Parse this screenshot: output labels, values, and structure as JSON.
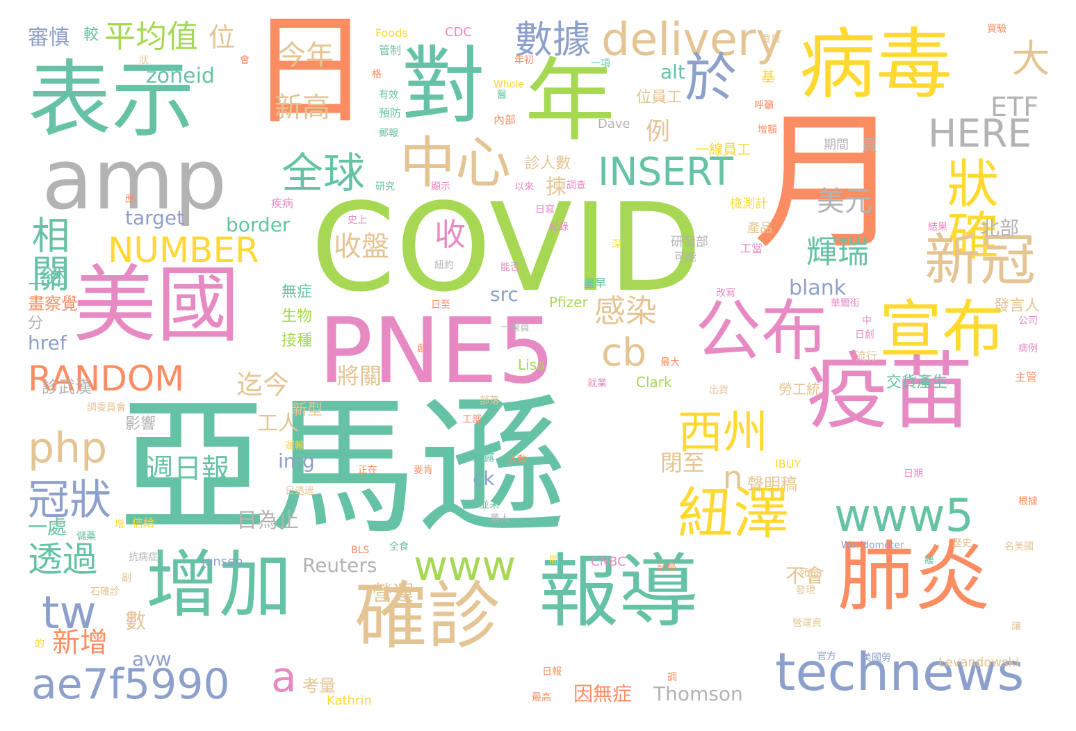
{
  "palette": {
    "teal": "#66c2a5",
    "coral": "#fc8d62",
    "blue": "#8da0cb",
    "pink": "#e78ac3",
    "green": "#a6d854",
    "yellow": "#ffd92f",
    "tan": "#e5c494",
    "gray": "#b3b3b3"
  },
  "words": [
    {
      "text": "亞馬遜",
      "color": "teal"
    },
    {
      "text": "COVID",
      "color": "green"
    },
    {
      "text": "月",
      "color": "coral"
    },
    {
      "text": "PNE5",
      "color": "pink"
    },
    {
      "text": "表示",
      "color": "teal"
    },
    {
      "text": "日",
      "color": "coral"
    },
    {
      "text": "對",
      "color": "teal"
    },
    {
      "text": "年",
      "color": "green"
    },
    {
      "text": "病毒",
      "color": "yellow"
    },
    {
      "text": "amp",
      "color": "gray"
    },
    {
      "text": "美國",
      "color": "pink"
    },
    {
      "text": "疫苗",
      "color": "pink"
    },
    {
      "text": "增加",
      "color": "teal"
    },
    {
      "text": "確診",
      "color": "tan"
    },
    {
      "text": "報導",
      "color": "teal"
    },
    {
      "text": "肺炎",
      "color": "coral"
    },
    {
      "text": "公布",
      "color": "pink"
    },
    {
      "text": "宣布",
      "color": "yellow"
    },
    {
      "text": "delivery",
      "color": "tan"
    },
    {
      "text": "於",
      "color": "blue"
    },
    {
      "text": "中心",
      "color": "tan"
    },
    {
      "text": "狀確",
      "color": "yellow"
    },
    {
      "text": "新冠",
      "color": "tan"
    },
    {
      "text": "technews",
      "color": "blue"
    },
    {
      "text": "ae7f5990",
      "color": "blue"
    },
    {
      "text": "紐澤",
      "color": "yellow"
    },
    {
      "text": "西州",
      "color": "yellow"
    },
    {
      "text": "www5",
      "color": "teal"
    },
    {
      "text": "www",
      "color": "green"
    },
    {
      "text": "RANDOM",
      "color": "coral"
    },
    {
      "text": "NUMBER",
      "color": "yellow"
    },
    {
      "text": "INSERT",
      "color": "teal"
    },
    {
      "text": "HERE",
      "color": "gray"
    },
    {
      "text": "數據",
      "color": "blue"
    },
    {
      "text": "全球",
      "color": "teal"
    },
    {
      "text": "大",
      "color": "tan"
    },
    {
      "text": "相關",
      "color": "teal"
    },
    {
      "text": "平均值",
      "color": "green"
    },
    {
      "text": "位",
      "color": "tan"
    },
    {
      "text": "審慎",
      "color": "blue"
    },
    {
      "text": "較",
      "color": "teal"
    },
    {
      "text": "今年",
      "color": "tan"
    },
    {
      "text": "新高",
      "color": "tan"
    },
    {
      "text": "zoneid",
      "color": "teal"
    },
    {
      "text": "php",
      "color": "tan"
    },
    {
      "text": "冠狀",
      "color": "blue"
    },
    {
      "text": "tw",
      "color": "blue"
    },
    {
      "text": "透過",
      "color": "teal"
    },
    {
      "text": "cb",
      "color": "tan"
    },
    {
      "text": "感染",
      "color": "tan"
    },
    {
      "text": "收盤",
      "color": "tan"
    },
    {
      "text": "收",
      "color": "pink"
    },
    {
      "text": "輝瑞",
      "color": "teal"
    },
    {
      "text": "美元",
      "color": "gray"
    },
    {
      "text": "ETF",
      "color": "gray"
    },
    {
      "text": "alt",
      "color": "teal"
    },
    {
      "text": "例",
      "color": "tan"
    },
    {
      "text": "迄今",
      "color": "tan"
    },
    {
      "text": "週日報",
      "color": "teal"
    },
    {
      "text": "n",
      "color": "tan"
    },
    {
      "text": "a",
      "color": "pink"
    },
    {
      "text": "新增",
      "color": "coral"
    },
    {
      "text": "target",
      "color": "blue"
    },
    {
      "text": "border",
      "color": "teal"
    },
    {
      "text": "上述",
      "color": "teal"
    },
    {
      "text": "src",
      "color": "blue"
    },
    {
      "text": "blank",
      "color": "blue"
    },
    {
      "text": "北部",
      "color": "gray"
    },
    {
      "text": "工人",
      "color": "tan"
    },
    {
      "text": "img",
      "color": "blue"
    },
    {
      "text": "閉至",
      "color": "tan"
    },
    {
      "text": "將關",
      "color": "tan"
    },
    {
      "text": "日為止",
      "color": "gray"
    },
    {
      "text": "Reuters",
      "color": "gray"
    },
    {
      "text": "Thomson",
      "color": "gray"
    },
    {
      "text": "營運",
      "color": "tan"
    },
    {
      "text": "不會",
      "color": "tan"
    },
    {
      "text": "因無症",
      "color": "coral"
    },
    {
      "text": "考量",
      "color": "tan"
    },
    {
      "text": "聲明稿",
      "color": "tan"
    },
    {
      "text": "一處",
      "color": "teal"
    },
    {
      "text": "avw",
      "color": "blue"
    },
    {
      "text": "ck",
      "color": "blue"
    },
    {
      "text": "數",
      "color": "tan"
    },
    {
      "text": "href",
      "color": "blue"
    },
    {
      "text": "分",
      "color": "gray"
    },
    {
      "text": "畫察覺",
      "color": "coral"
    },
    {
      "text": "生物",
      "color": "green"
    },
    {
      "text": "無症",
      "color": "teal"
    },
    {
      "text": "接種",
      "color": "green"
    },
    {
      "text": "新型",
      "color": "tan"
    },
    {
      "text": "影響",
      "color": "gray"
    },
    {
      "text": "診武漢",
      "color": "gray"
    },
    {
      "text": "位員工",
      "color": "tan"
    },
    {
      "text": "一線員工",
      "color": "yellow"
    },
    {
      "text": "員",
      "color": "gray"
    },
    {
      "text": "期間",
      "color": "gray"
    },
    {
      "text": "揀",
      "color": "tan"
    },
    {
      "text": "診人數",
      "color": "tan"
    },
    {
      "text": "檢測計",
      "color": "yellow"
    },
    {
      "text": "產品",
      "color": "tan"
    },
    {
      "text": "研發部",
      "color": "gray"
    },
    {
      "text": "可能",
      "color": "gray"
    },
    {
      "text": "工當",
      "color": "pink"
    },
    {
      "text": "Pfizer",
      "color": "green"
    },
    {
      "text": "發言人",
      "color": "tan"
    },
    {
      "text": "交貨產生",
      "color": "teal"
    },
    {
      "text": "勞工統",
      "color": "tan"
    },
    {
      "text": "Clark",
      "color": "green"
    },
    {
      "text": "Lisa",
      "color": "green"
    },
    {
      "text": "Dave",
      "color": "gray"
    },
    {
      "text": "Whole",
      "color": "yellow"
    },
    {
      "text": "Foods",
      "color": "yellow"
    },
    {
      "text": "CDC",
      "color": "pink"
    },
    {
      "text": "Jansen",
      "color": "blue"
    },
    {
      "text": "CNBC",
      "color": "pink"
    },
    {
      "text": "IBUY",
      "color": "yellow"
    },
    {
      "text": "Worldometer",
      "color": "blue"
    },
    {
      "text": "Levandowski",
      "color": "tan"
    },
    {
      "text": "Kathrin",
      "color": "yellow"
    },
    {
      "text": "BLS",
      "color": "coral"
    },
    {
      "text": "管制",
      "color": "teal"
    },
    {
      "text": "有效",
      "color": "teal"
    },
    {
      "text": "預防",
      "color": "teal"
    },
    {
      "text": "郵報",
      "color": "teal"
    },
    {
      "text": "內部",
      "color": "coral"
    },
    {
      "text": "一項",
      "color": "teal"
    },
    {
      "text": "年初",
      "color": "coral"
    },
    {
      "text": "醫",
      "color": "teal"
    },
    {
      "text": "呼籲",
      "color": "coral"
    },
    {
      "text": "增額",
      "color": "coral"
    },
    {
      "text": "結果",
      "color": "pink"
    },
    {
      "text": "深",
      "color": "yellow"
    },
    {
      "text": "改寫",
      "color": "pink"
    },
    {
      "text": "紐約",
      "color": "gray"
    },
    {
      "text": "史上",
      "color": "pink"
    },
    {
      "text": "疾病",
      "color": "pink"
    },
    {
      "text": "研究",
      "color": "teal"
    },
    {
      "text": "顯示",
      "color": "pink"
    },
    {
      "text": "以來",
      "color": "pink"
    },
    {
      "text": "調查",
      "color": "pink"
    },
    {
      "text": "日寫",
      "color": "pink"
    },
    {
      "text": "紀錄",
      "color": "pink"
    },
    {
      "text": "能否",
      "color": "pink"
    },
    {
      "text": "盡早",
      "color": "teal"
    },
    {
      "text": "日至",
      "color": "coral"
    },
    {
      "text": "華爾街",
      "color": "pink"
    },
    {
      "text": "公司",
      "color": "pink"
    },
    {
      "text": "病例",
      "color": "pink"
    },
    {
      "text": "主管",
      "color": "coral"
    },
    {
      "text": "流行",
      "color": "tan"
    },
    {
      "text": "日創",
      "color": "pink"
    },
    {
      "text": "中",
      "color": "pink"
    },
    {
      "text": "一線員",
      "color": "gray"
    },
    {
      "text": "創",
      "color": "coral"
    },
    {
      "text": "最大",
      "color": "coral"
    },
    {
      "text": "就業",
      "color": "pink"
    },
    {
      "text": "出貨",
      "color": "tan"
    },
    {
      "text": "部落",
      "color": "tan"
    },
    {
      "text": "工部",
      "color": "coral"
    },
    {
      "text": "透露",
      "color": "teal"
    },
    {
      "text": "人數",
      "color": "coral"
    },
    {
      "text": "正在",
      "color": "coral"
    },
    {
      "text": "麥肯",
      "color": "coral"
    },
    {
      "text": "並未",
      "color": "teal"
    },
    {
      "text": "萬人",
      "color": "gray"
    },
    {
      "text": "日期",
      "color": "pink"
    },
    {
      "text": "根據",
      "color": "coral"
    },
    {
      "text": "歷史",
      "color": "tan"
    },
    {
      "text": "名美國",
      "color": "tan"
    },
    {
      "text": "發現",
      "color": "tan"
    },
    {
      "text": "死亡",
      "color": "tan"
    },
    {
      "text": "計局",
      "color": "coral"
    },
    {
      "text": "間",
      "color": "yellow"
    },
    {
      "text": "緩",
      "color": "teal"
    },
    {
      "text": "讓",
      "color": "tan"
    },
    {
      "text": "營運資",
      "color": "tan"
    },
    {
      "text": "官方",
      "color": "blue"
    },
    {
      "text": "美國勞",
      "color": "blue"
    },
    {
      "text": "日報",
      "color": "coral"
    },
    {
      "text": "調",
      "color": "coral"
    },
    {
      "text": "最高",
      "color": "coral"
    },
    {
      "text": "全食",
      "color": "teal"
    },
    {
      "text": "信給",
      "color": "yellow"
    },
    {
      "text": "增",
      "color": "yellow"
    },
    {
      "text": "儲藥",
      "color": "teal"
    },
    {
      "text": "抗病症",
      "color": "gray"
    },
    {
      "text": "副",
      "color": "tan"
    },
    {
      "text": "石確診",
      "color": "tan"
    },
    {
      "text": "的",
      "color": "yellow"
    },
    {
      "text": "調委員會",
      "color": "tan"
    },
    {
      "text": "運輸",
      "color": "yellow"
    },
    {
      "text": "日透過",
      "color": "tan"
    },
    {
      "text": "基",
      "color": "yellow"
    },
    {
      "text": "買賣",
      "color": "tan"
    },
    {
      "text": "買驗",
      "color": "coral"
    },
    {
      "text": "格",
      "color": "coral"
    },
    {
      "text": "狀",
      "color": "tan"
    },
    {
      "text": "會",
      "color": "coral"
    },
    {
      "text": "應",
      "color": "coral"
    }
  ]
}
